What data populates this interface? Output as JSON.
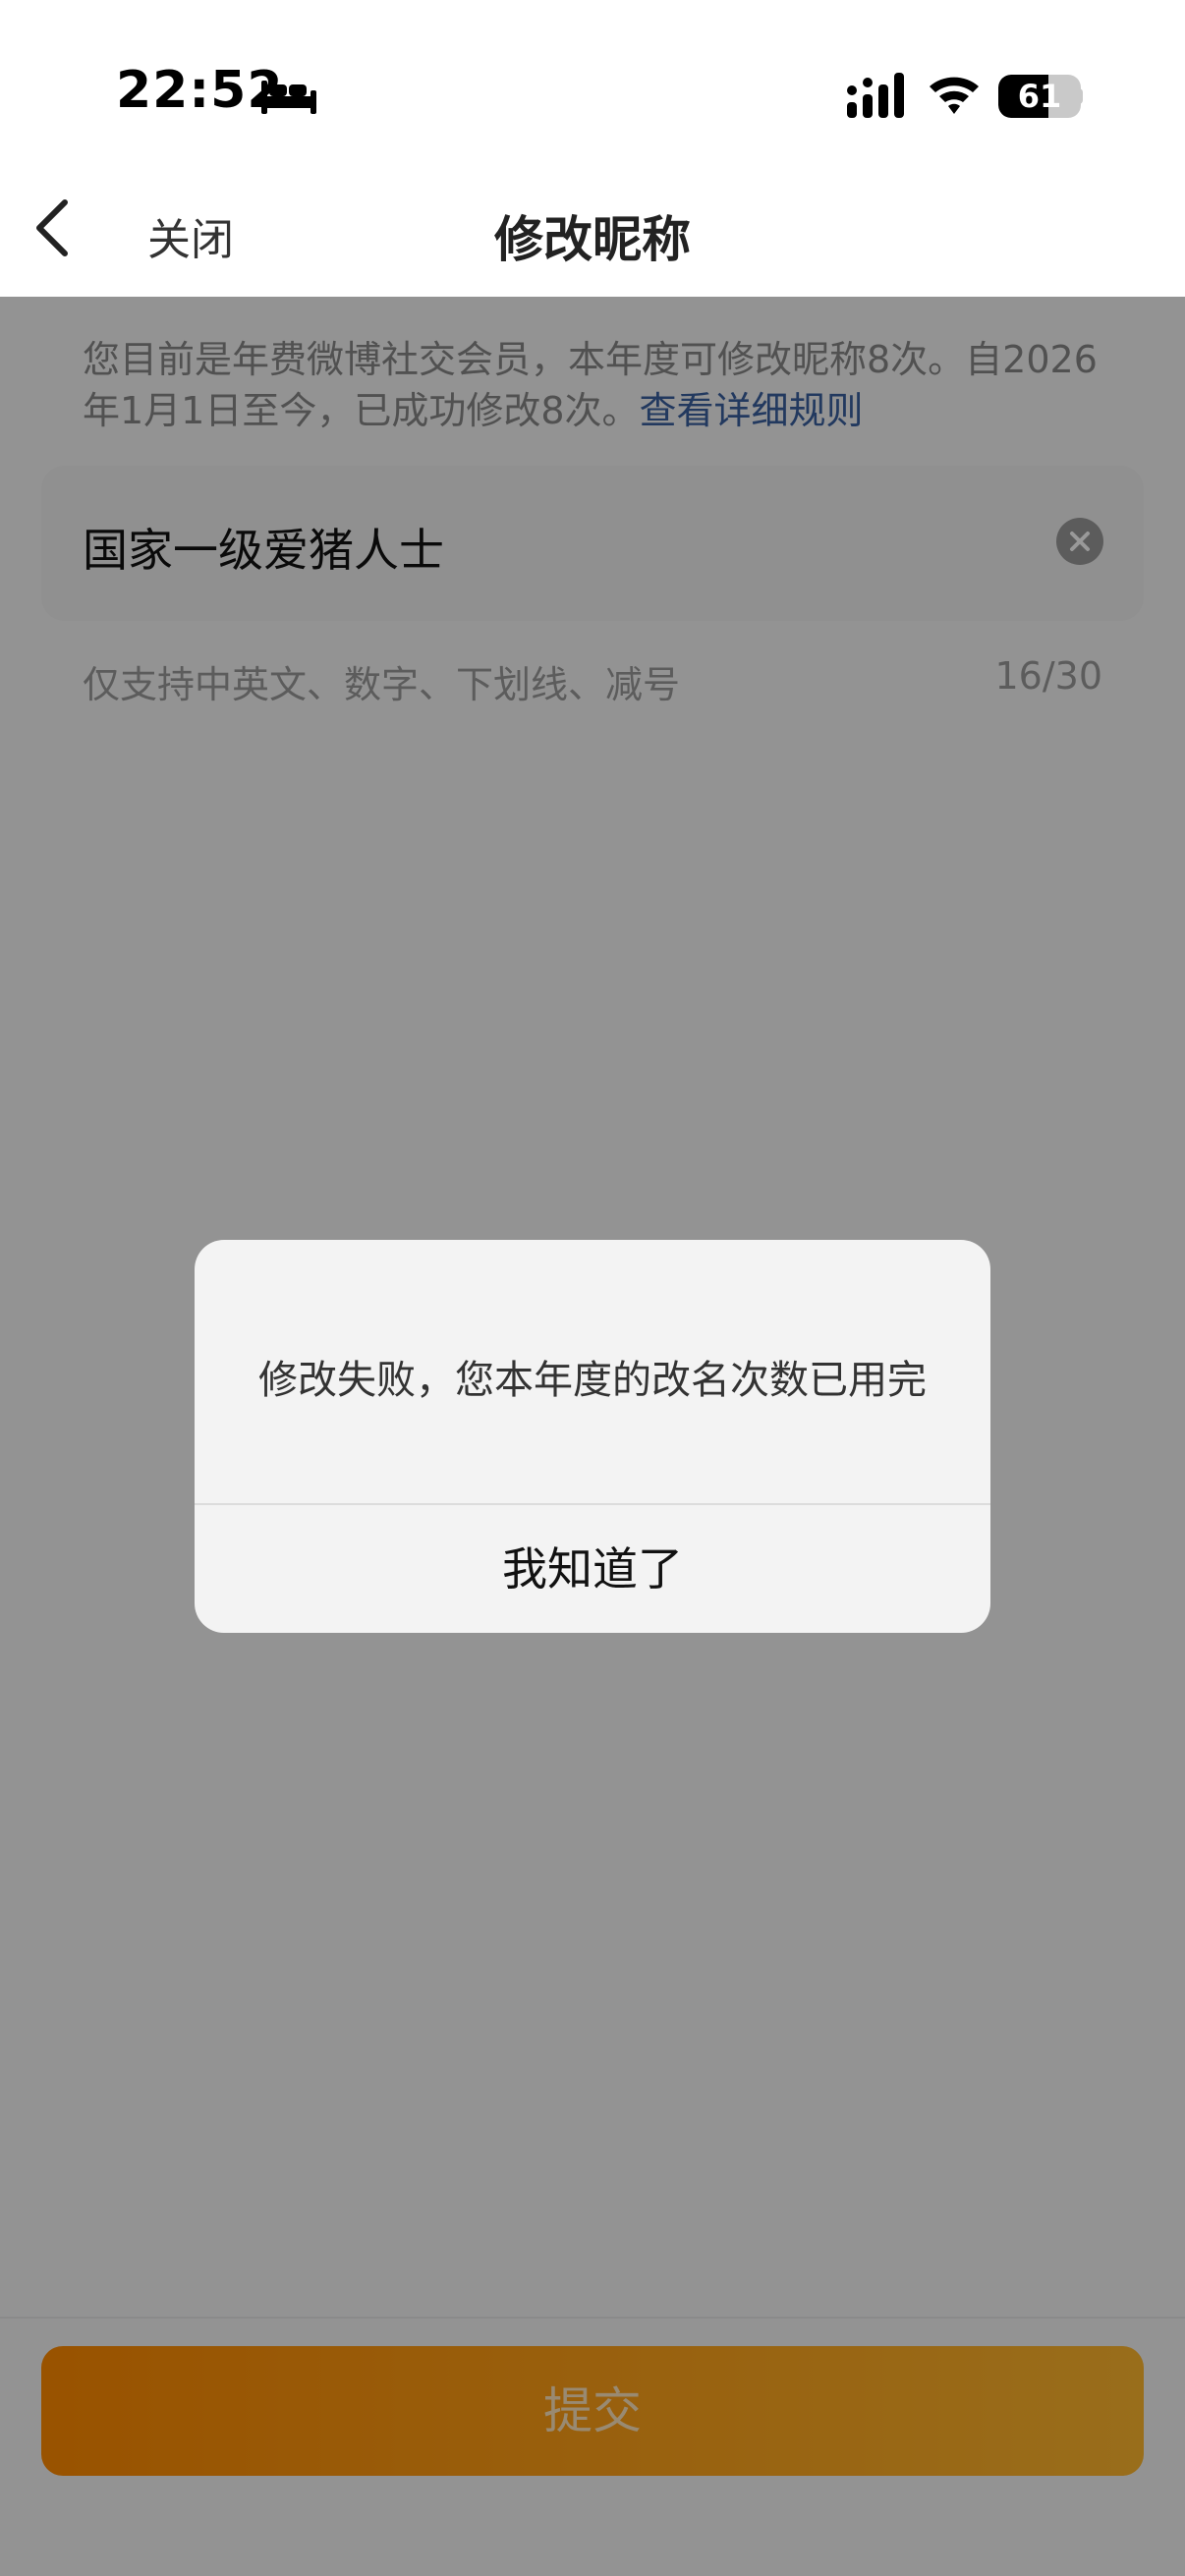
{
  "status_bar": {
    "time": "22:52",
    "battery_level": 61,
    "battery_text": "61",
    "icons": [
      "bed-icon",
      "signal-icon",
      "wifi-icon",
      "battery-icon"
    ]
  },
  "nav": {
    "back_icon": "chevron-left-icon",
    "close_label": "关闭",
    "title": "修改昵称"
  },
  "notice": {
    "text": "您目前是年费微博社交会员，本年度可修改昵称8次。自2026年1月1日至今，已成功修改8次。",
    "link_text": "查看详细规则"
  },
  "name_field": {
    "value": "国家一级爱猪人士",
    "clear_icon": "clear-icon"
  },
  "hint": {
    "text": "仅支持中英文、数字、下划线、减号",
    "counter": "16/30"
  },
  "submit": {
    "label": "提交"
  },
  "dialog": {
    "message": "修改失败，您本年度的改名次数已用完",
    "button_label": "我知道了"
  },
  "colors": {
    "accent_start": "#ff8a00",
    "accent_end": "#ffb72e",
    "link": "#3a5f9e",
    "overlay": "rgba(0,0,0,0.4)"
  }
}
